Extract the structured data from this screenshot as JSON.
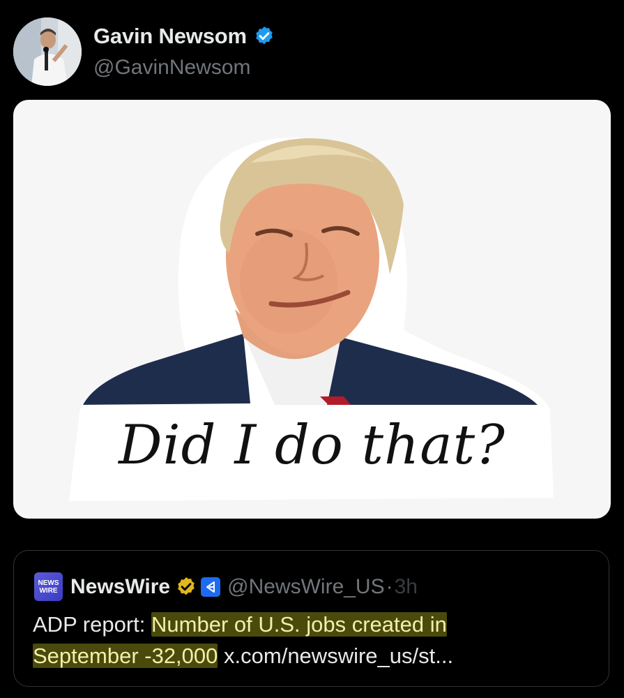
{
  "author": {
    "name": "Gavin Newsom",
    "handle": "@GavinNewsom",
    "verified": true,
    "avatar_icon": "profile-photo"
  },
  "media": {
    "caption": "Did I do that?"
  },
  "quoted_post": {
    "logo_line1": "NEWS",
    "logo_line2": "WIRE",
    "name": "NewsWire",
    "handle": "@NewsWire_US",
    "separator": "·",
    "time": "3h",
    "text_plain": "ADP report: ",
    "text_highlight_1": "Number of U.S. jobs created in",
    "text_highlight_2": "September -32,000",
    "link": "x.com/newswire_us/st..."
  },
  "colors": {
    "background": "#000000",
    "verified_blue": "#1d9bf0",
    "gold_badge": "#e2b719",
    "highlight": "#e6e628"
  }
}
